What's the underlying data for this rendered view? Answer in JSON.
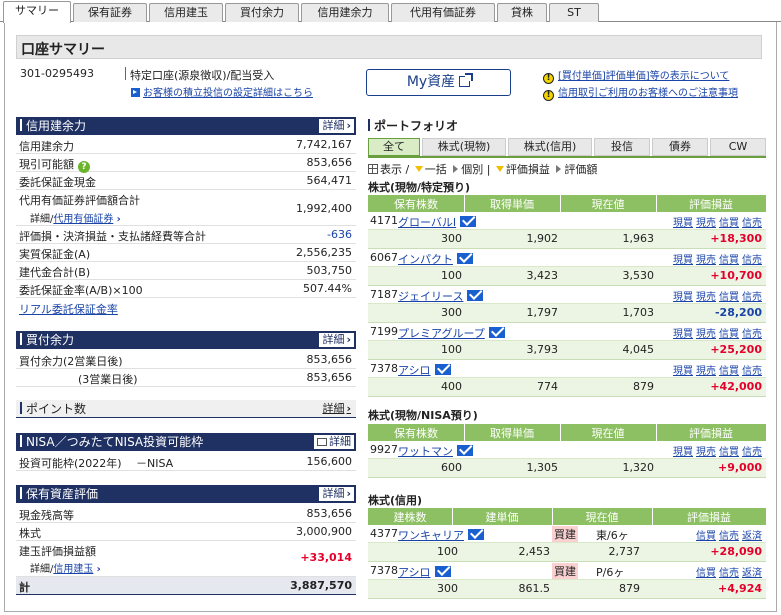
{
  "tabs": [
    "サマリー",
    "保有証券",
    "信用建玉",
    "買付余力",
    "信用建余力",
    "代用有価証券",
    "貸株",
    "ST"
  ],
  "page_title": "口座サマリー",
  "account": {
    "number": "301-0295493",
    "type": "特定口座(源泉徴収)/配当受入",
    "settings_link": "お客様の積立投信の設定詳細はこちら"
  },
  "my_asset_button": "My資産",
  "notices": [
    "[買付単価]評価単価]等の表示について",
    "信用取引ご利用のお客様へのご注意事項"
  ],
  "detail_label": "詳細",
  "margin": {
    "title": "信用建余力",
    "rows": [
      {
        "label": "信用建余力",
        "value": "7,742,167"
      },
      {
        "label": "現引可能額",
        "value": "853,656"
      },
      {
        "label": "委託保証金現金",
        "value": "564,471"
      },
      {
        "label": "代用有価証券評価額合計",
        "value": "1,992,400",
        "sub_prefix": "詳細/",
        "sub_link": "代用有価証券"
      },
      {
        "label": "評価損・決済損益・支払諸経費等合計",
        "value": "-636"
      },
      {
        "label": "実質保証金(A)",
        "value": "2,556,235"
      },
      {
        "label": "建代金合計(B)",
        "value": "503,750"
      },
      {
        "label": "委託保証金率(A/B)×100",
        "value": "507.44%"
      }
    ],
    "link": "リアル委託保証金率"
  },
  "purchase": {
    "title": "買付余力",
    "rows": [
      {
        "label": "買付余力(2営業日後)",
        "value": "853,656"
      },
      {
        "label": "(3営業日後)",
        "value": "853,656"
      }
    ]
  },
  "points": {
    "title": "ポイント数"
  },
  "nisa": {
    "title": "NISA／つみたてNISA投資可能枠",
    "label": "投資可能枠(2022年)",
    "kind": "－NISA",
    "value": "156,600"
  },
  "holdings": {
    "title": "保有資産評価",
    "rows": [
      {
        "label": "現金残高等",
        "value": "853,656"
      },
      {
        "label": "株式",
        "value": "3,000,900"
      },
      {
        "label": "建玉評価損益額",
        "value": "+33,014",
        "sub_prefix": "詳細/",
        "sub_link": "信用建玉"
      }
    ],
    "total_label": "計",
    "total_value": "3,887,570"
  },
  "portfolio": {
    "title": "ポートフォリオ",
    "tabs": [
      "全て",
      "株式(現物)",
      "株式(信用)",
      "投信",
      "債券",
      "CW"
    ],
    "toolbar": {
      "display": "表示",
      "batch": "一括",
      "single": "個別",
      "pl": "評価損益",
      "amount": "評価額"
    },
    "spot_specific": {
      "title": "株式(現物/特定預り)",
      "headers": [
        "保有株数",
        "取得単価",
        "現在値",
        "評価損益"
      ],
      "actions": [
        "現買",
        "現売",
        "信買",
        "信売"
      ],
      "rows": [
        {
          "code": "4171",
          "name": "グローバルI",
          "qty": "300",
          "cost": "1,902",
          "price": "1,963",
          "pl": "+18,300"
        },
        {
          "code": "6067",
          "name": "インパクト",
          "qty": "100",
          "cost": "3,423",
          "price": "3,530",
          "pl": "+10,700"
        },
        {
          "code": "7187",
          "name": "ジェイリース",
          "qty": "300",
          "cost": "1,797",
          "price": "1,703",
          "pl": "-28,200"
        },
        {
          "code": "7199",
          "name": "プレミアグループ",
          "qty": "100",
          "cost": "3,793",
          "price": "4,045",
          "pl": "+25,200"
        },
        {
          "code": "7378",
          "name": "アシロ",
          "qty": "400",
          "cost": "774",
          "price": "879",
          "pl": "+42,000"
        }
      ]
    },
    "spot_nisa": {
      "title": "株式(現物/NISA預り)",
      "headers": [
        "保有株数",
        "取得単価",
        "現在値",
        "評価損益"
      ],
      "actions": [
        "現買",
        "現売",
        "信買",
        "信売"
      ],
      "rows": [
        {
          "code": "9927",
          "name": "ワットマン",
          "qty": "600",
          "cost": "1,305",
          "price": "1,320",
          "pl": "+9,000"
        }
      ]
    },
    "margin_pos": {
      "title": "株式(信用)",
      "headers": [
        "建株数",
        "建単価",
        "現在値",
        "評価損益"
      ],
      "actions": [
        "信買",
        "信売",
        "返済"
      ],
      "rows": [
        {
          "code": "4377",
          "name": "ワンキャリア",
          "side": "買建",
          "term": "東/6ヶ",
          "qty": "100",
          "cost": "2,453",
          "price": "2,737",
          "pl": "+28,090"
        },
        {
          "code": "7378",
          "name": "アシロ",
          "side": "買建",
          "term": "P/6ヶ",
          "qty": "300",
          "cost": "861.5",
          "price": "879",
          "pl": "+4,924"
        }
      ]
    }
  },
  "colors": {
    "navy": "#1f3063",
    "green": "#8dc063",
    "red": "#e4002b",
    "link": "#1a44a8"
  }
}
